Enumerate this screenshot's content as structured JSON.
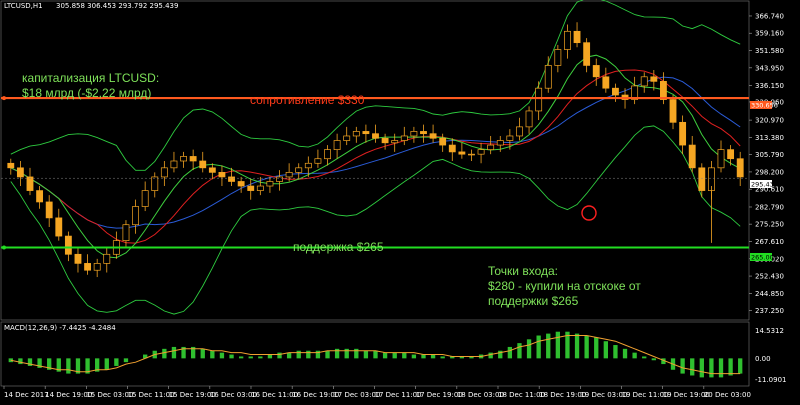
{
  "header": {
    "symbol": "LTCUSD,H1",
    "ohlc": "305.858 306.453 293.792 295.439"
  },
  "macd_header": "MACD(12,26,9) -7.4425 -4.2484",
  "annotations": {
    "cap_line1": "капитализация LTCUSD:",
    "cap_line2": "$18 млрд (-$2,22 млрд)",
    "resistance": "сопротивление $330",
    "support": "поддержка $265",
    "entry_line1": "Точки входа:",
    "entry_line2": "$280 - купили на отскоке от",
    "entry_line3": "поддержки $265"
  },
  "price_tags": {
    "resistance": "330.656",
    "current": "295.439",
    "support": "265.003"
  },
  "colors": {
    "background": "#000000",
    "bull_candle": "#f5a623",
    "bear_candle": "#f5a623",
    "bollinger": "#2ecc40",
    "ma_red": "#e02020",
    "ma_blue": "#2a5bd7",
    "ma_green": "#3ecf3e",
    "resistance_line": "#ff5a1f",
    "support_line": "#22dd22",
    "macd_hist": "#2fbf2f",
    "macd_signal": "#f0a030"
  },
  "chart_data": {
    "type": "line",
    "title": "",
    "y_ticks": [
      "366.740",
      "359.160",
      "351.580",
      "343.950",
      "336.150",
      "328.960",
      "320.970",
      "313.380",
      "305.790",
      "298.200",
      "290.610",
      "282.790",
      "275.250",
      "267.610",
      "260.020",
      "252.430",
      "244.850",
      "237.250"
    ],
    "ylim": [
      234,
      372
    ],
    "x_ticks": [
      "14 Dec 2017",
      "14 Dec 19:00",
      "15 Dec 03:00",
      "15 Dec 11:00",
      "15 Dec 19:00",
      "16 Dec 03:00",
      "16 Dec 11:00",
      "16 Dec 19:00",
      "17 Dec 03:00",
      "17 Dec 11:00",
      "17 Dec 19:00",
      "18 Dec 03:00",
      "18 Dec 11:00",
      "18 Dec 19:00",
      "19 Dec 03:00",
      "19 Dec 11:00",
      "19 Dec 19:00",
      "20 Dec 03:00"
    ],
    "macd_ticks": [
      "14.5312",
      "0.00",
      "-11.0901"
    ],
    "macd_ylim": [
      -14,
      17
    ],
    "resistance_level": 330.656,
    "support_level": 265.003,
    "current_price": 295.439,
    "price_series": [
      300,
      296,
      290,
      285,
      278,
      270,
      262,
      258,
      255,
      258,
      262,
      268,
      275,
      283,
      290,
      296,
      300,
      303,
      305,
      303,
      300,
      298,
      296,
      294,
      292,
      290,
      292,
      294,
      296,
      298,
      300,
      302,
      304,
      308,
      312,
      314,
      316,
      315,
      313,
      311,
      312,
      314,
      316,
      315,
      313,
      310,
      307,
      306,
      306,
      308,
      310,
      312,
      314,
      318,
      325,
      335,
      345,
      352,
      360,
      355,
      345,
      340,
      335,
      332,
      330,
      336,
      340,
      338,
      330,
      320,
      310,
      300,
      290,
      300,
      308,
      304,
      296
    ],
    "macd_hist": [
      -2,
      -3,
      -4,
      -5,
      -6,
      -7,
      -8,
      -8,
      -8,
      -7,
      -6,
      -4,
      -2,
      0,
      2,
      4,
      5,
      6,
      6,
      6,
      5,
      4,
      3,
      2,
      1,
      1,
      1,
      2,
      3,
      3,
      4,
      4,
      4,
      4,
      5,
      5,
      5,
      4,
      4,
      3,
      3,
      3,
      2,
      2,
      2,
      1,
      1,
      1,
      1,
      2,
      3,
      4,
      6,
      8,
      10,
      12,
      13,
      14,
      14,
      13,
      12,
      11,
      9,
      7,
      5,
      3,
      1,
      -1,
      -3,
      -6,
      -8,
      -9,
      -10,
      -10,
      -10,
      -9,
      -8
    ],
    "macd_signal": [
      -1,
      -2,
      -3,
      -4,
      -5,
      -6,
      -6,
      -7,
      -7,
      -6,
      -6,
      -5,
      -3,
      -2,
      0,
      2,
      3,
      4,
      5,
      5,
      5,
      4,
      4,
      3,
      3,
      2,
      2,
      2,
      2,
      3,
      3,
      3,
      3,
      4,
      4,
      4,
      4,
      4,
      4,
      3,
      3,
      3,
      3,
      2,
      2,
      2,
      1,
      1,
      1,
      1,
      2,
      3,
      4,
      6,
      7,
      9,
      10,
      11,
      12,
      12,
      12,
      11,
      10,
      9,
      7,
      5,
      3,
      1,
      -1,
      -3,
      -5,
      -6,
      -7,
      -8,
      -8,
      -8,
      -8
    ]
  }
}
